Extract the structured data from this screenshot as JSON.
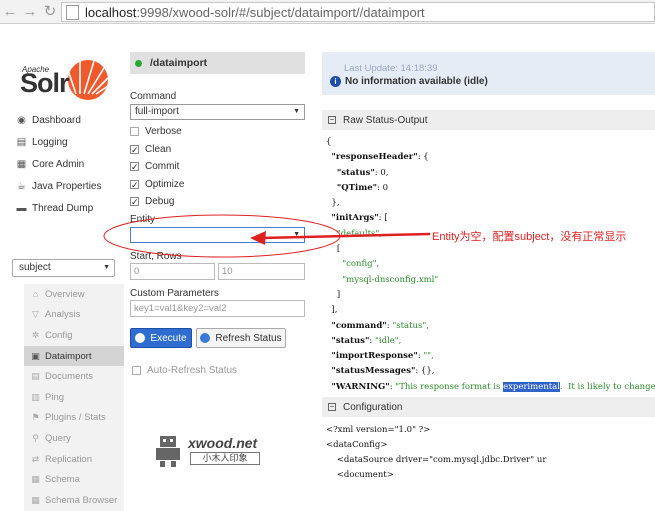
{
  "browser": {
    "url_host": "localhost",
    "url_path": ":9998/xwood-solr/#/subject/dataimport//dataimport"
  },
  "logo": {
    "small": "Apache",
    "big": "Solr"
  },
  "sidebar": {
    "items": [
      {
        "label": "Dashboard",
        "icon": "dashboard-icon"
      },
      {
        "label": "Logging",
        "icon": "logging-icon"
      },
      {
        "label": "Core Admin",
        "icon": "core-admin-icon"
      },
      {
        "label": "Java Properties",
        "icon": "java-properties-icon"
      },
      {
        "label": "Thread Dump",
        "icon": "thread-dump-icon"
      }
    ],
    "core_selected": "subject",
    "core_menu": [
      {
        "label": "Overview",
        "icon": "home-icon"
      },
      {
        "label": "Analysis",
        "icon": "funnel-icon"
      },
      {
        "label": "Config",
        "icon": "gear-icon"
      },
      {
        "label": "Dataimport",
        "icon": "import-icon",
        "active": true
      },
      {
        "label": "Documents",
        "icon": "documents-icon"
      },
      {
        "label": "Ping",
        "icon": "ping-icon"
      },
      {
        "label": "Plugins / Stats",
        "icon": "plugins-icon"
      },
      {
        "label": "Query",
        "icon": "query-icon"
      },
      {
        "label": "Replication",
        "icon": "replication-icon"
      },
      {
        "label": "Schema",
        "icon": "schema-icon"
      },
      {
        "label": "Schema Browser",
        "icon": "schema-browser-icon"
      }
    ]
  },
  "dataimport": {
    "title": "/dataimport",
    "command_label": "Command",
    "command_value": "full-import",
    "options": [
      {
        "label": "Verbose",
        "checked": false
      },
      {
        "label": "Clean",
        "checked": true
      },
      {
        "label": "Commit",
        "checked": true
      },
      {
        "label": "Optimize",
        "checked": true
      },
      {
        "label": "Debug",
        "checked": true
      }
    ],
    "entity_label": "Entity",
    "entity_value": "",
    "start_rows_label": "Start, Rows",
    "start_value": "0",
    "rows_value": "10",
    "custom_params_label": "Custom Parameters",
    "custom_params_placeholder": "key1=val1&key2=val2",
    "execute_label": "Execute",
    "refresh_label": "Refresh Status",
    "auto_refresh_label": "Auto-Refresh Status"
  },
  "status": {
    "last_update": "Last Update: 14:18:39",
    "info": "No information available (idle)",
    "raw_title": "Raw Status-Output",
    "config_title": "Configuration"
  },
  "raw_output": {
    "l1": "{",
    "l2_k": "\"responseHeader\"",
    "l2_r": ": {",
    "l3_k": "\"status\"",
    "l3_r": ": 0,",
    "l4_k": "\"QTime\"",
    "l4_r": ": 0",
    "l5": "},",
    "l6_k": "\"initArgs\"",
    "l6_r": ": [",
    "l7": "\"defaults\",",
    "l8": "[",
    "l9": "\"config\",",
    "l10": "\"mysql-dnsconfig.xml\"",
    "l11": "]",
    "l12": "],",
    "l13_k": "\"command\"",
    "l13_v": "\"status\",",
    "l14_k": "\"status\"",
    "l14_v": "\"idle\",",
    "l15_k": "\"importResponse\"",
    "l15_v": "\"\",",
    "l16_k": "\"statusMessages\"",
    "l16_v": "{},",
    "l17_k": "\"WARNING\"",
    "l17_v1": "\"This response format is ",
    "l17_sel": "experimental",
    "l17_v2": ".  It is likely to change",
    "l18": "}"
  },
  "config_output": {
    "c1": "<?xml version=\"1.0\" ?>",
    "c2": "<dataConfig>",
    "c3": "<dataSource driver=\"com.mysql.jdbc.Driver\" ur",
    "c4": "<document>"
  },
  "annotation": {
    "text": "Entity为空，配置subject，没有正常显示",
    "color": "#e02020"
  },
  "watermark": {
    "brand": "xwood.net",
    "sub": "小木人印象"
  }
}
